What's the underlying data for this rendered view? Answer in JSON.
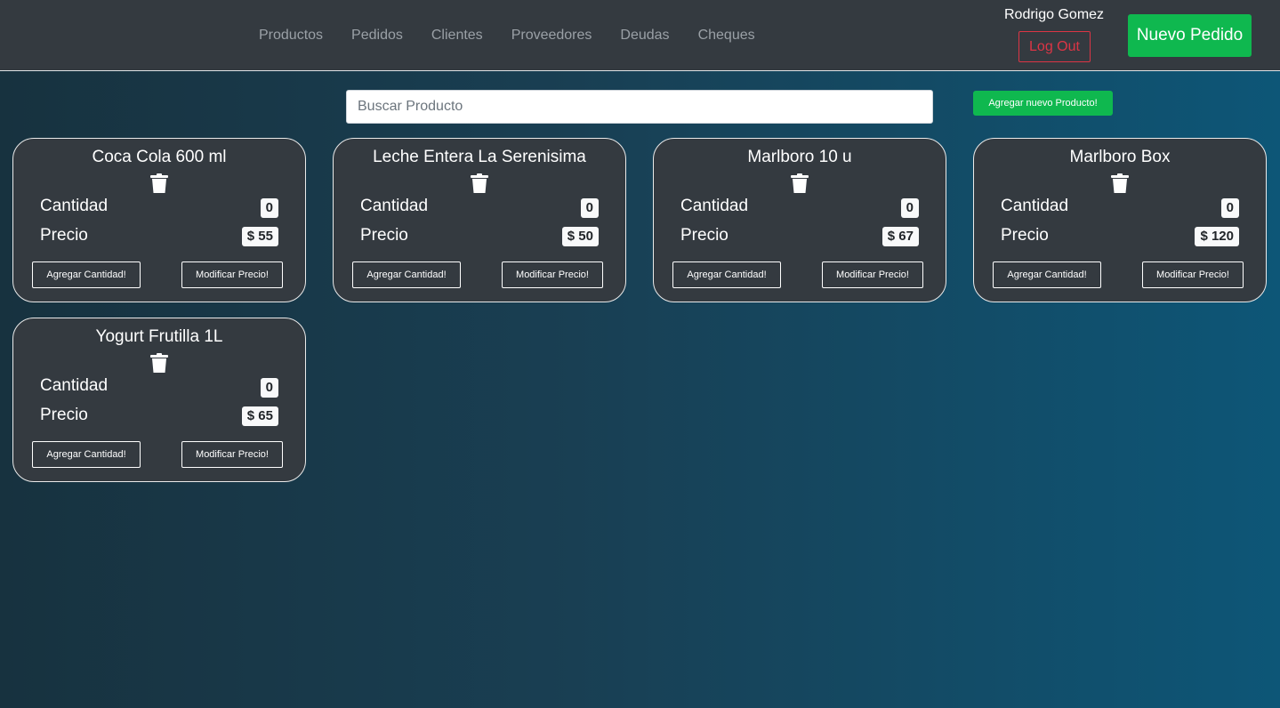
{
  "navbar": {
    "links": [
      "Productos",
      "Pedidos",
      "Clientes",
      "Proveedores",
      "Deudas",
      "Cheques"
    ],
    "user_name": "Rodrigo Gomez",
    "logout_label": "Log Out",
    "new_order_label": "Nuevo Pedido"
  },
  "search": {
    "placeholder": "Buscar Producto",
    "value": ""
  },
  "add_product_label": "Agregar nuevo Producto!",
  "labels": {
    "quantity": "Cantidad",
    "price": "Precio",
    "add_quantity": "Agregar Cantidad!",
    "modify_price": "Modificar Precio!"
  },
  "products": [
    {
      "name": "Coca Cola 600 ml",
      "quantity": "0",
      "price": "$ 55"
    },
    {
      "name": "Leche Entera La Serenisima",
      "quantity": "0",
      "price": "$ 50"
    },
    {
      "name": "Marlboro 10 u",
      "quantity": "0",
      "price": "$ 67"
    },
    {
      "name": "Marlboro Box",
      "quantity": "0",
      "price": "$ 120"
    },
    {
      "name": "Yogurt Frutilla 1L",
      "quantity": "0",
      "price": "$ 65"
    }
  ],
  "colors": {
    "navbar_bg": "#343a40",
    "success": "#0fb84f",
    "danger": "#dc3545"
  }
}
